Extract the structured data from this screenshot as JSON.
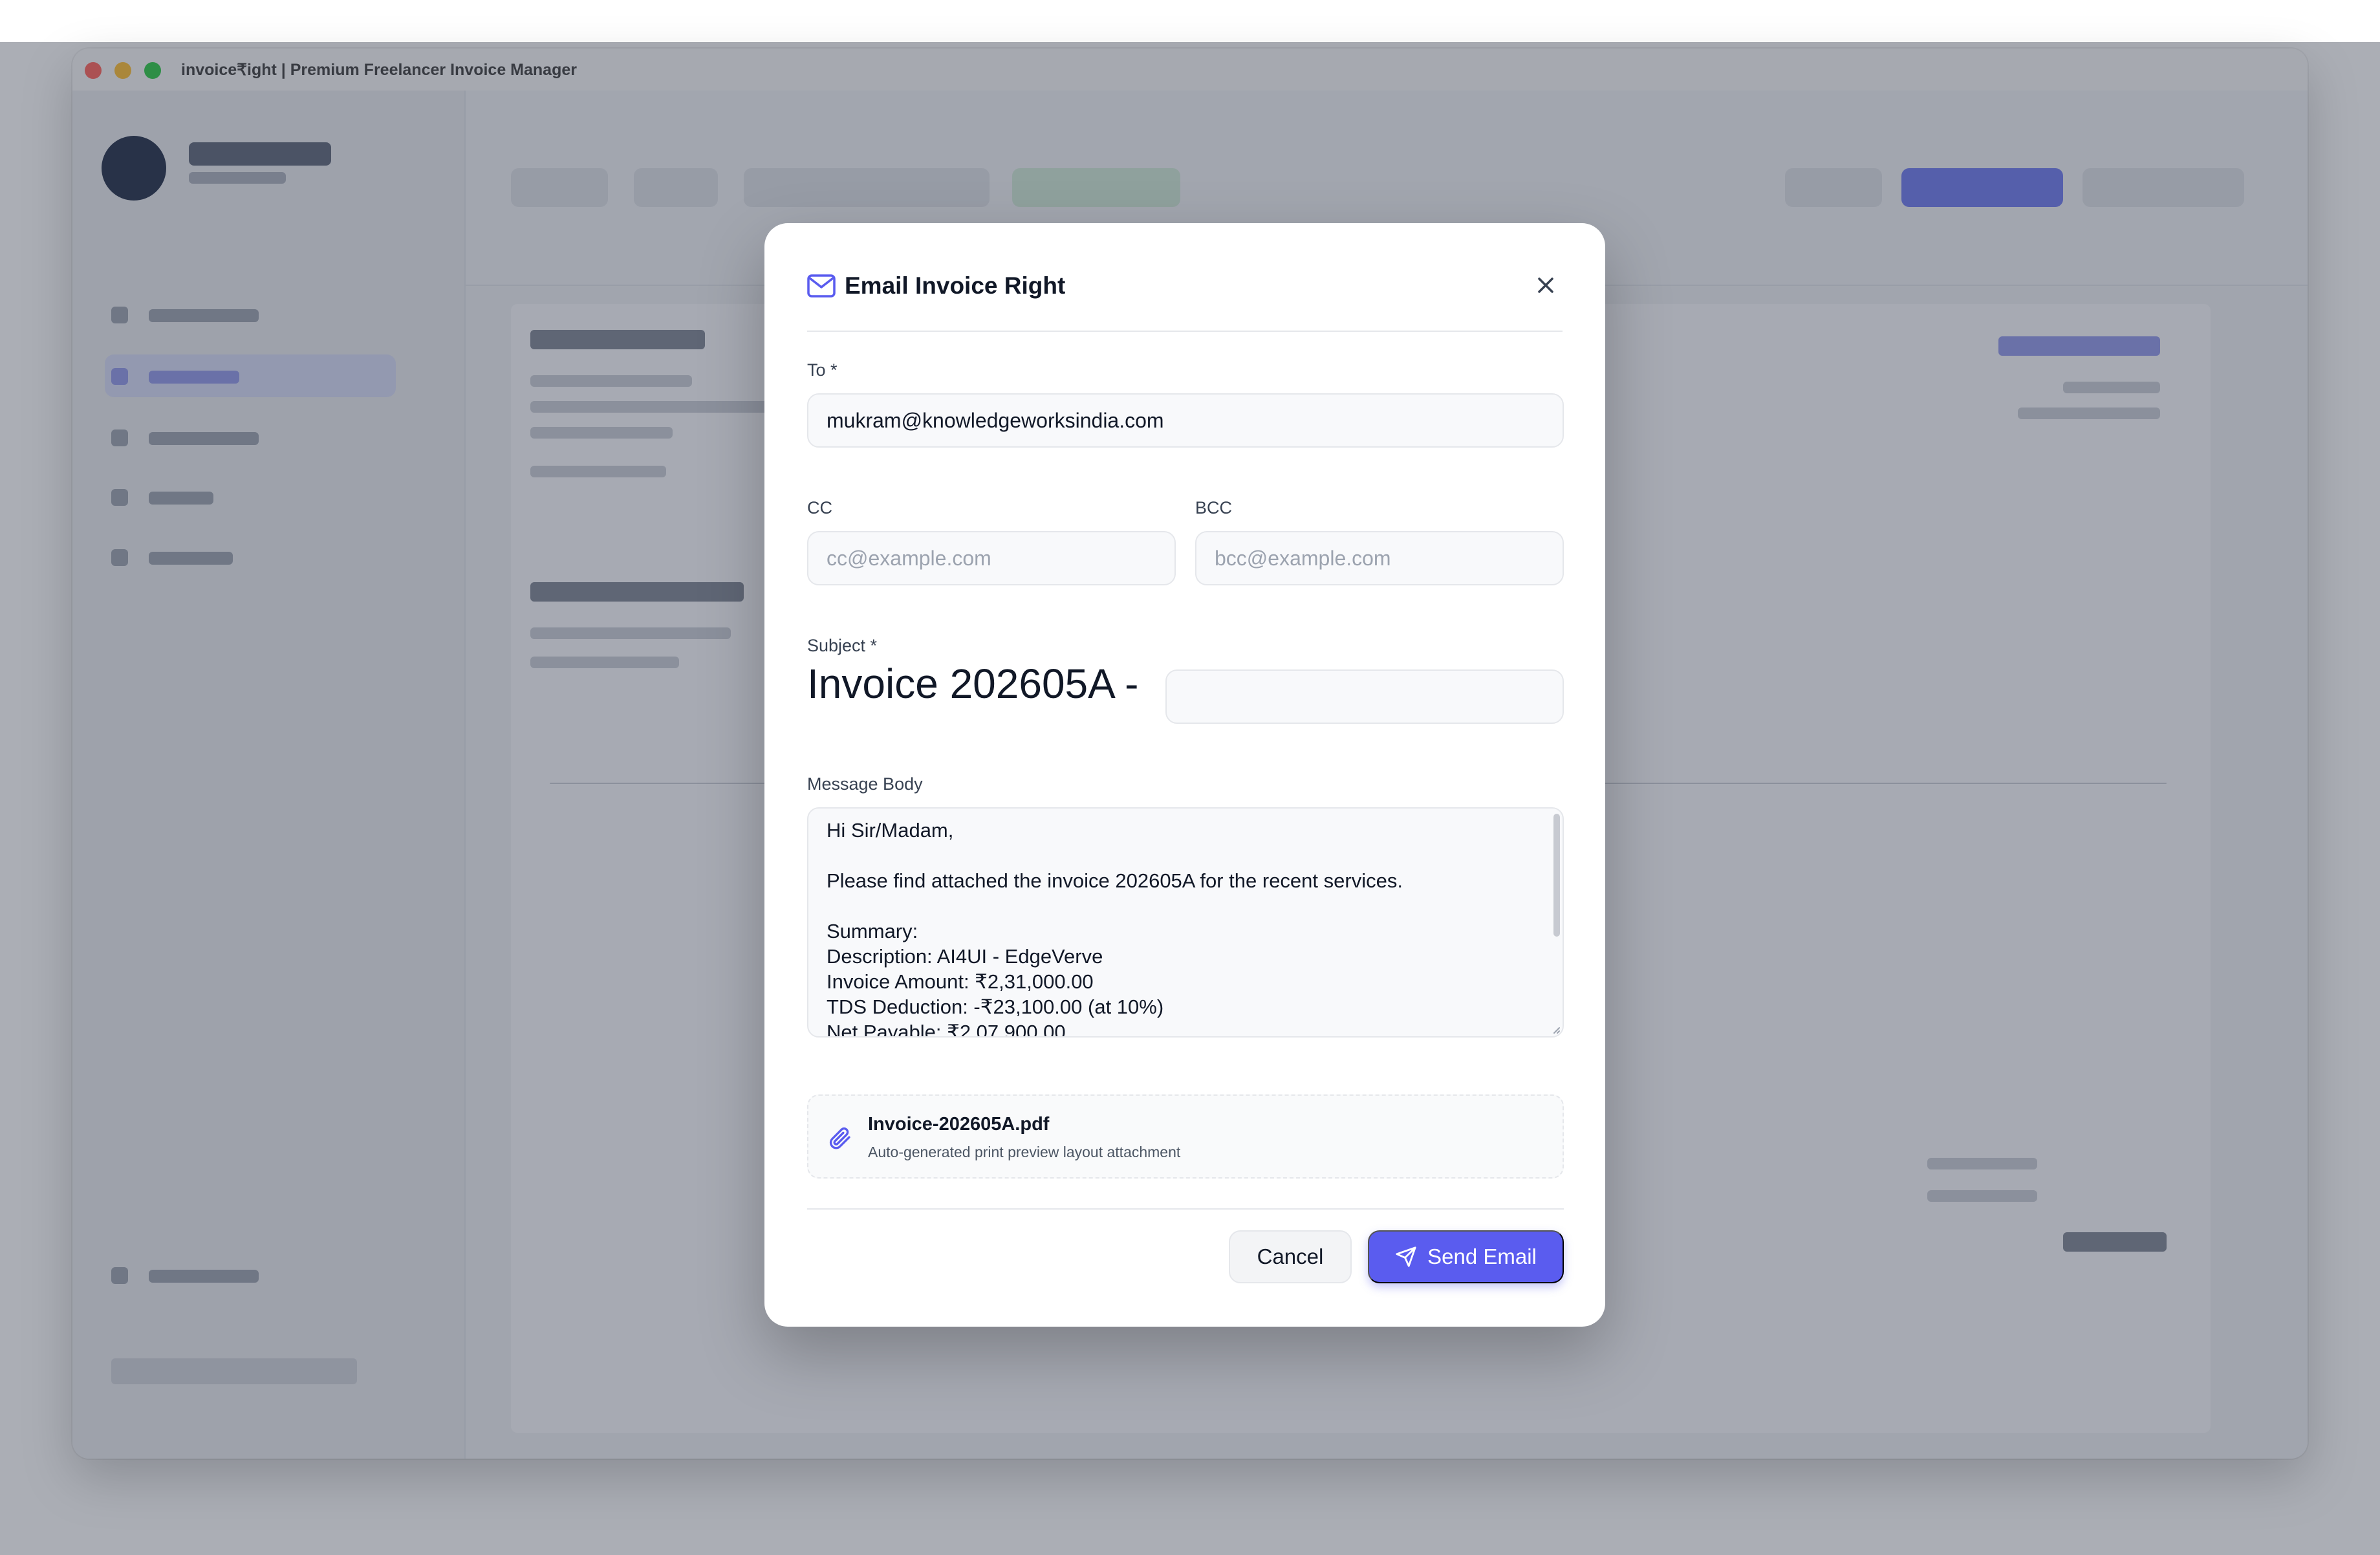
{
  "window": {
    "title": "invoice₹ight | Premium Freelancer Invoice Manager"
  },
  "modal": {
    "title": "Email Invoice Right",
    "to": {
      "label": "To *",
      "value": "mukram@knowledgeworksindia.com"
    },
    "cc": {
      "label": "CC",
      "placeholder": "cc@example.com"
    },
    "bcc": {
      "label": "BCC",
      "placeholder": "bcc@example.com"
    },
    "subject": {
      "label": "Subject *",
      "value": "Invoice 202605A -"
    },
    "message": {
      "label": "Message Body",
      "body": "Hi Sir/Madam,\n\nPlease find attached the invoice 202605A for the recent services.\n\nSummary:\nDescription: AI4UI - EdgeVerve\nInvoice Amount: ₹2,31,000.00\nTDS Deduction: -₹23,100.00 (at 10%)\nNet Payable: ₹2,07,900.00"
    },
    "attachment": {
      "filename": "Invoice-202605A.pdf",
      "description": "Auto-generated print preview layout attachment"
    },
    "buttons": {
      "cancel": "Cancel",
      "send": "Send Email"
    }
  },
  "colors": {
    "accent": "#5a5cef",
    "overlay": "rgba(55,62,78,0.42)"
  },
  "icons": {
    "title": "mail-icon",
    "close": "close-icon",
    "attachment": "paperclip-icon",
    "send": "paper-plane-icon"
  }
}
